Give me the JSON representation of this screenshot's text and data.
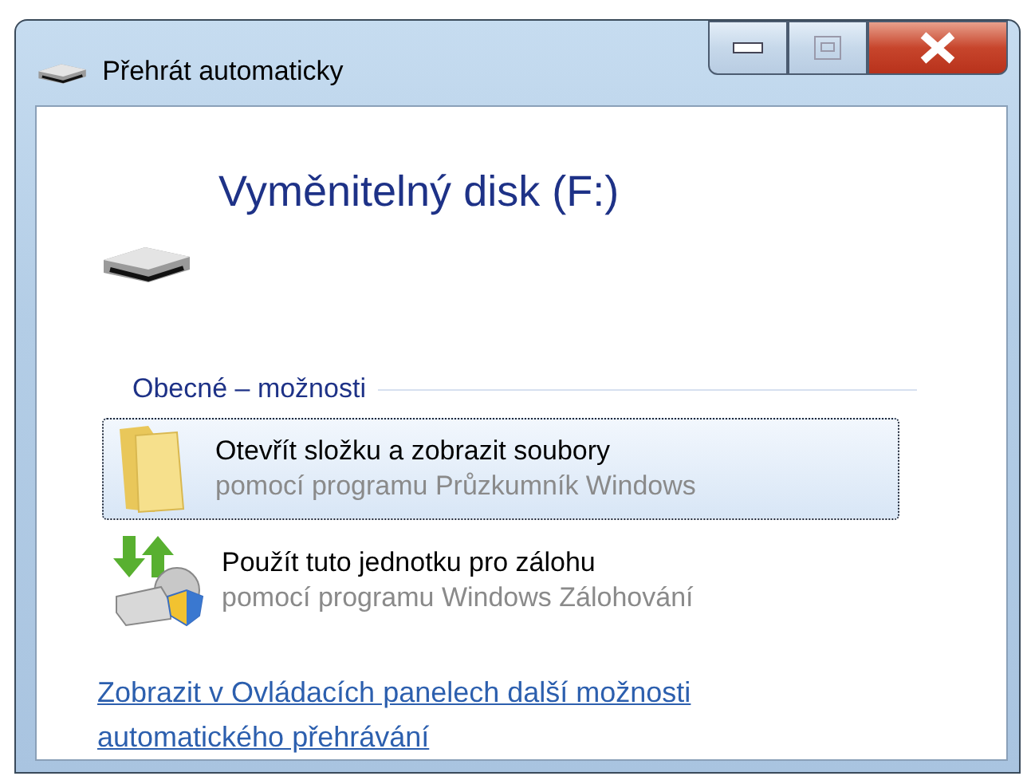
{
  "window": {
    "title": "Přehrát automaticky"
  },
  "device": {
    "name": "Vyměnitelný disk (F:)"
  },
  "section": {
    "label": "Obecné – možnosti"
  },
  "options": [
    {
      "kind": "folder",
      "title": "Otevřít složku a zobrazit soubory",
      "subtitle": "pomocí programu Průzkumník Windows",
      "selected": true
    },
    {
      "kind": "backup",
      "title": "Použít tuto jednotku pro zálohu",
      "subtitle": "pomocí programu Windows Zálohování",
      "selected": false
    }
  ],
  "link": "Zobrazit v Ovládacích panelech další možnosti automatického přehrávání"
}
